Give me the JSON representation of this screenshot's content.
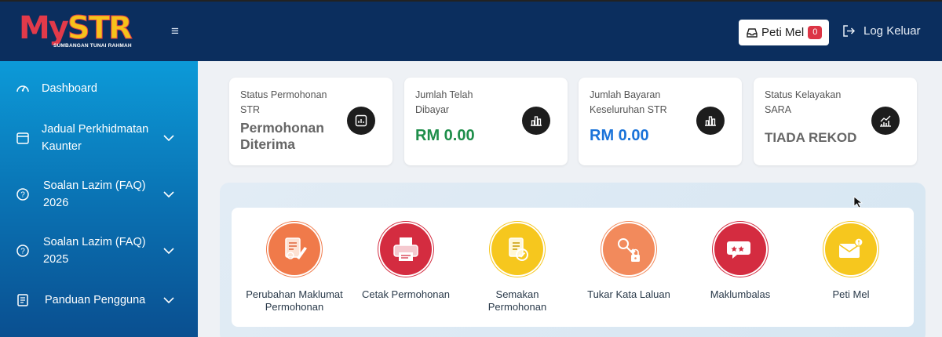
{
  "header": {
    "logo_main_m": "My",
    "logo_main_s": "STR",
    "logo_tagline": "SUMBANGAN TUNAI RAHMAH",
    "menu_icon": "hamburger-icon",
    "mailbox_label": "Peti Mel",
    "mailbox_count": "0",
    "logout_label": "Log Keluar"
  },
  "sidebar": {
    "items": [
      {
        "label": "Dashboard",
        "icon": "speedometer-icon"
      },
      {
        "label": "Jadual Perkhidmatan Kaunter",
        "icon": "calendar-icon"
      },
      {
        "label": "Soalan Lazim (FAQ) 2026",
        "icon": "question-circle-icon"
      },
      {
        "label": "Soalan Lazim (FAQ) 2025",
        "icon": "question-circle-icon"
      },
      {
        "label": "Panduan Pengguna",
        "icon": "document-icon"
      }
    ]
  },
  "cards": [
    {
      "label": "Status Permohonan STR",
      "value": "Permohonan Diterima",
      "icon": "chart-box-icon"
    },
    {
      "label": "Jumlah Telah Dibayar",
      "value": "RM 0.00",
      "icon": "bar-chart-icon",
      "color": "#1e8e4a"
    },
    {
      "label": "Jumlah Bayaran Keseluruhan STR",
      "value": "RM 0.00",
      "icon": "bar-chart-icon",
      "color": "#1a73d9"
    },
    {
      "label": "Status Kelayakan SARA",
      "value": "TIADA REKOD",
      "icon": "trend-chart-icon"
    }
  ],
  "services": [
    {
      "label": "Perubahan Maklumat Permohonan",
      "icon": "edit-document-icon",
      "color": "#f07a4a"
    },
    {
      "label": "Cetak Permohonan",
      "icon": "printer-icon",
      "color": "#d42c40"
    },
    {
      "label": "Semakan Permohonan",
      "icon": "check-document-icon",
      "color": "#f6c71e"
    },
    {
      "label": "Tukar Kata Laluan",
      "icon": "key-lock-icon",
      "color": "#f28a5c"
    },
    {
      "label": "Maklumbalas",
      "icon": "feedback-icon",
      "color": "#d42c40"
    },
    {
      "label": "Peti Mel",
      "icon": "envelope-icon",
      "color": "#f6c71e"
    }
  ]
}
